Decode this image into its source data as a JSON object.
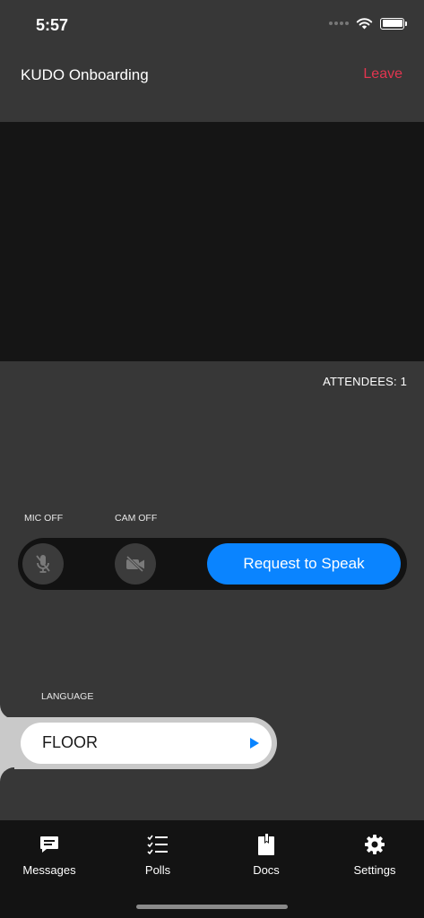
{
  "status_bar": {
    "time": "5:57"
  },
  "header": {
    "title": "KUDO Onboarding",
    "leave_label": "Leave"
  },
  "attendees": {
    "label": "ATTENDEES: 1"
  },
  "controls": {
    "mic_label": "MIC OFF",
    "cam_label": "CAM OFF",
    "mic_icon": "mic-off-icon",
    "cam_icon": "camera-off-icon",
    "request_label": "Request to Speak"
  },
  "language": {
    "label": "LANGUAGE",
    "value": "FLOOR"
  },
  "tabs": [
    {
      "label": "Messages",
      "icon": "message-icon"
    },
    {
      "label": "Polls",
      "icon": "checklist-icon"
    },
    {
      "label": "Docs",
      "icon": "document-icon"
    },
    {
      "label": "Settings",
      "icon": "gear-icon"
    }
  ],
  "colors": {
    "accent": "#0a84ff",
    "leave": "#e2354f",
    "background": "#373737",
    "video": "#151515",
    "tab_bar": "#131313"
  }
}
